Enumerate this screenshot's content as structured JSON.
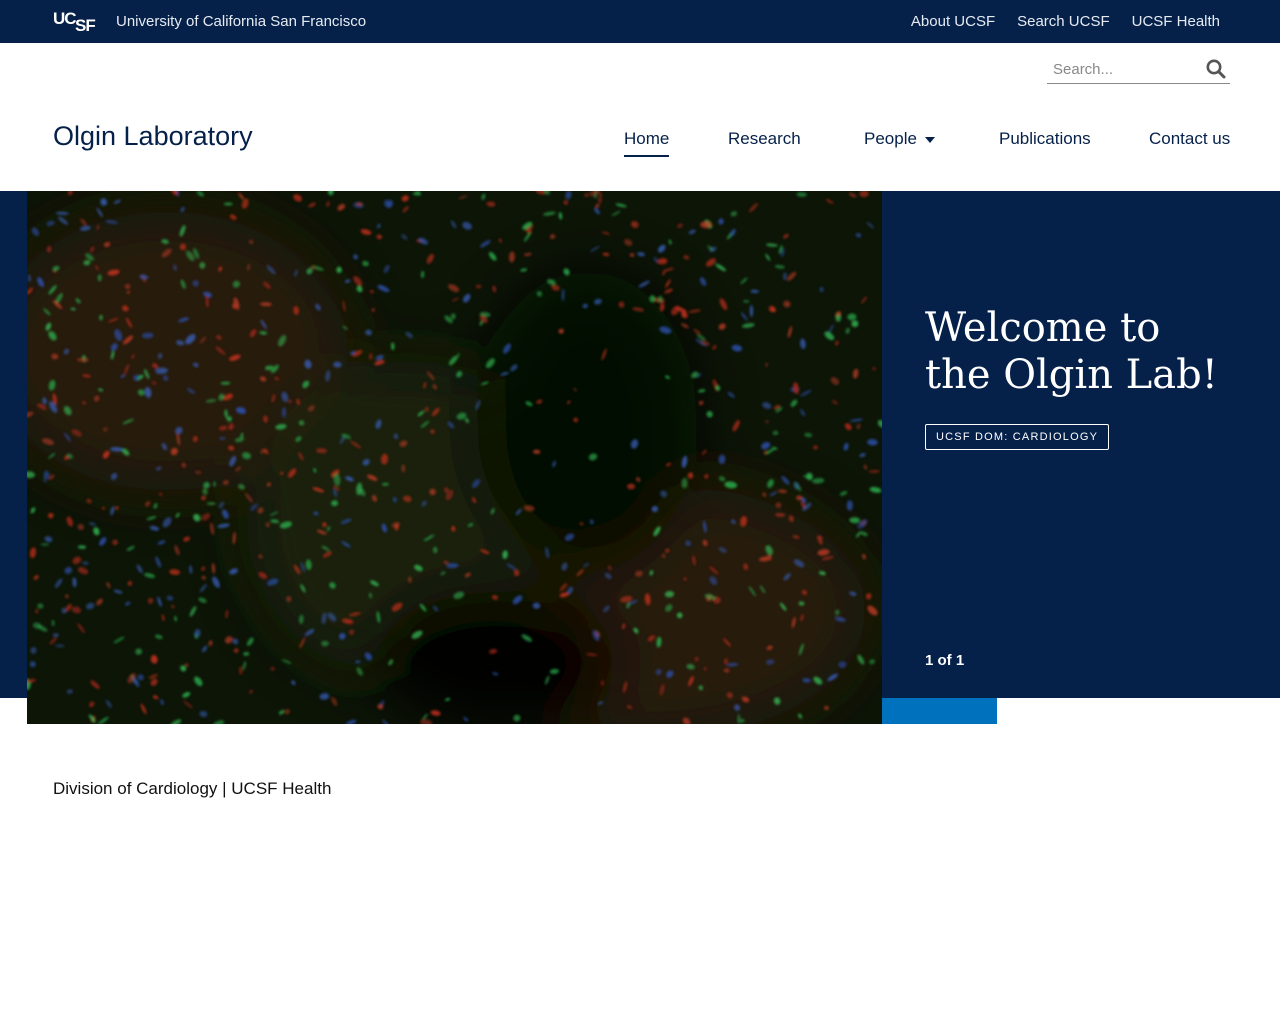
{
  "topbar": {
    "logo_text": "UCSF",
    "university_name": "University of California San Francisco",
    "links": [
      "About UCSF",
      "Search UCSF",
      "UCSF Health"
    ]
  },
  "search": {
    "placeholder": "Search...",
    "value": "",
    "icon": "magnifier-icon"
  },
  "site": {
    "title": "Olgin Laboratory"
  },
  "nav": {
    "items": [
      {
        "label": "Home",
        "active": true
      },
      {
        "label": "Research"
      },
      {
        "label": "People",
        "has_dropdown": true,
        "icon": "caret-down-icon"
      },
      {
        "label": "Publications"
      },
      {
        "label": "Contact us"
      }
    ]
  },
  "hero": {
    "title_line1": "Welcome to",
    "title_line2": "the Olgin Lab!",
    "tag": "UCSF DOM: CARDIOLOGY",
    "counter": "1 of 1"
  },
  "content": {
    "division_text": "Division of Cardiology | UCSF Health"
  },
  "colors": {
    "navy": "#052049",
    "accent_blue": "#0071bc",
    "white": "#ffffff"
  }
}
